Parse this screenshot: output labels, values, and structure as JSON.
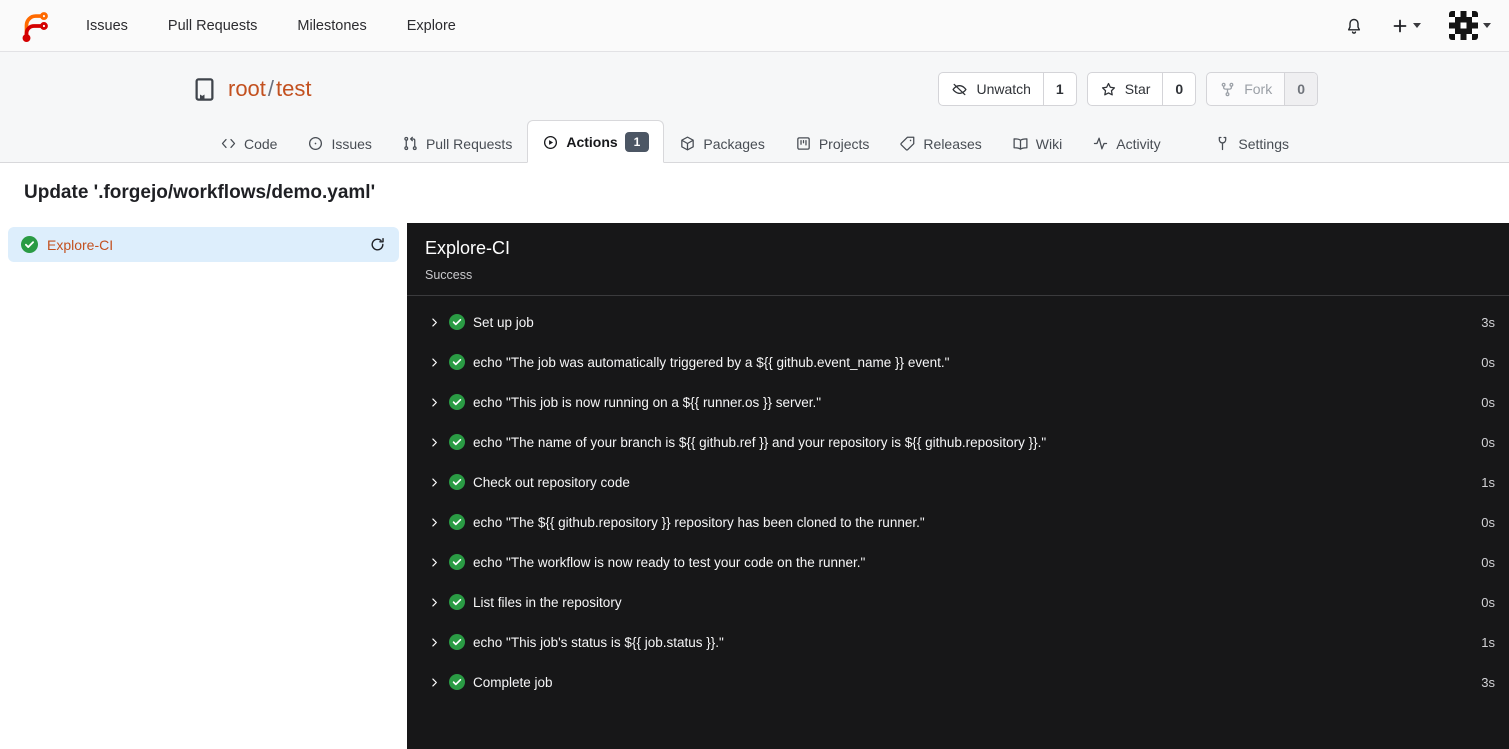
{
  "colors": {
    "accent_link": "#c35120",
    "nav_bg": "#fafafa",
    "section_bg": "#f6f7f8",
    "border": "#e2e2e5",
    "dark_panel_bg": "#171718",
    "dark_border": "#3b3b3d",
    "success_green": "#2a9b44",
    "badge_bg": "#4c5664",
    "sidebar_active_bg": "#ddeefc"
  },
  "navbar": {
    "links": [
      {
        "label": "Issues"
      },
      {
        "label": "Pull Requests"
      },
      {
        "label": "Milestones"
      },
      {
        "label": "Explore"
      }
    ],
    "icons": {
      "notifications": "bell-icon",
      "create_new": "plus-icon",
      "user_menu": "avatar-identicon"
    }
  },
  "repo": {
    "owner": "root",
    "separator": "/",
    "name": "test",
    "buttons": [
      {
        "label": "Unwatch",
        "count": "1"
      },
      {
        "label": "Star",
        "count": "0"
      },
      {
        "label": "Fork",
        "count": "0",
        "disabled": true
      }
    ]
  },
  "tabs": [
    {
      "label": "Code"
    },
    {
      "label": "Issues"
    },
    {
      "label": "Pull Requests"
    },
    {
      "label": "Actions",
      "badge": "1",
      "active": true
    },
    {
      "label": "Packages"
    },
    {
      "label": "Projects"
    },
    {
      "label": "Releases"
    },
    {
      "label": "Wiki"
    },
    {
      "label": "Activity"
    },
    {
      "label": "Settings"
    }
  ],
  "run": {
    "title": "Update '.forgejo/workflows/demo.yaml'"
  },
  "sidebar": {
    "job": {
      "name": "Explore-CI",
      "status": "success"
    }
  },
  "panel": {
    "title": "Explore-CI",
    "status": "Success",
    "steps": [
      {
        "name": "Set up job",
        "time": "3s"
      },
      {
        "name": "echo \"The job was automatically triggered by a ${{ github.event_name }} event.\"",
        "time": "0s"
      },
      {
        "name": "echo \"This job is now running on a ${{ runner.os }} server.\"",
        "time": "0s"
      },
      {
        "name": "echo \"The name of your branch is ${{ github.ref }} and your repository is ${{ github.repository }}.\"",
        "time": "0s"
      },
      {
        "name": "Check out repository code",
        "time": "1s"
      },
      {
        "name": "echo \"The ${{ github.repository }} repository has been cloned to the runner.\"",
        "time": "0s"
      },
      {
        "name": "echo \"The workflow is now ready to test your code on the runner.\"",
        "time": "0s"
      },
      {
        "name": "List files in the repository",
        "time": "0s"
      },
      {
        "name": "echo \"This job's status is ${{ job.status }}.\"",
        "time": "1s"
      },
      {
        "name": "Complete job",
        "time": "3s"
      }
    ]
  }
}
